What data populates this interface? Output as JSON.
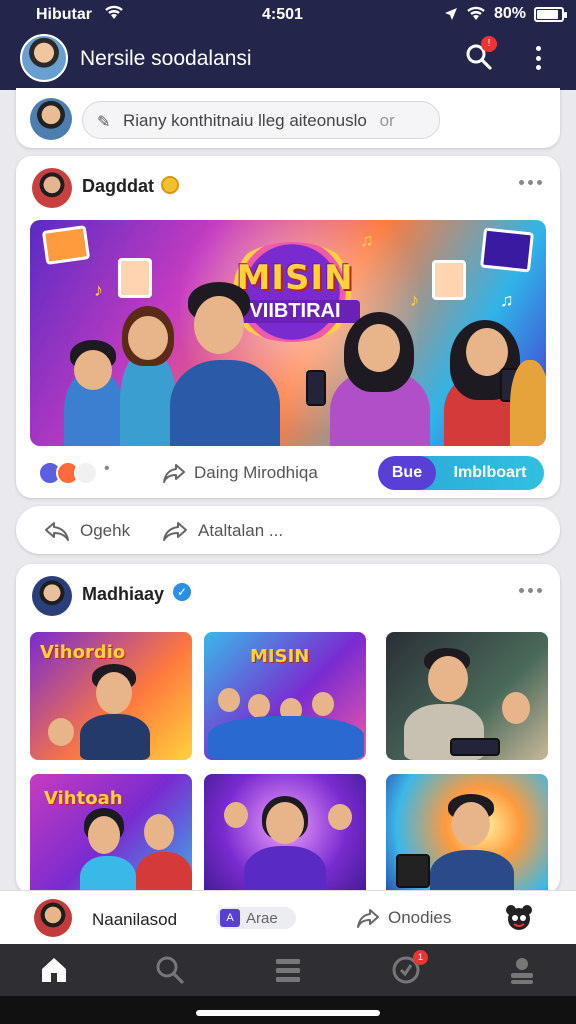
{
  "status_bar": {
    "carrier": "Hibutar",
    "time": "4:501",
    "battery": "80%"
  },
  "app_bar": {
    "title": "Nersile soodalansi",
    "notification_count": "!"
  },
  "composer": {
    "placeholder": "Riany konthitnaiu lleg aiteonuslo",
    "or_text": "or"
  },
  "post1": {
    "author": "Dagddat",
    "hero": {
      "title": "MISIN",
      "subtitle": "VIIBTIRAI"
    },
    "share_label": "Daing Mirodhiqa",
    "pill": {
      "left": "Bue",
      "right": "Imblboart"
    }
  },
  "action_bar": {
    "comment_label": "Ogehk",
    "share_label": "Ataltalan ..."
  },
  "post2": {
    "author": "Madhiaay",
    "thumbs": [
      {
        "label": "Vihordio"
      },
      {
        "label": "MISIN"
      },
      {
        "label": ""
      },
      {
        "label": "Vihtoah"
      },
      {
        "label": ""
      },
      {
        "label": ""
      }
    ]
  },
  "bottom_sheet": {
    "name": "Naanilasod",
    "tag": "Arae",
    "share_label": "Onodies"
  },
  "tab_bar": {
    "tabs": [
      "home-icon",
      "search-icon",
      "menu-icon",
      "notifications-icon",
      "profile-icon"
    ],
    "notification_count": "1"
  },
  "colors": {
    "header": "#23264a",
    "accent_purple": "#5a3fd6",
    "accent_teal": "#2ba7d8",
    "badge_red": "#e33333"
  }
}
